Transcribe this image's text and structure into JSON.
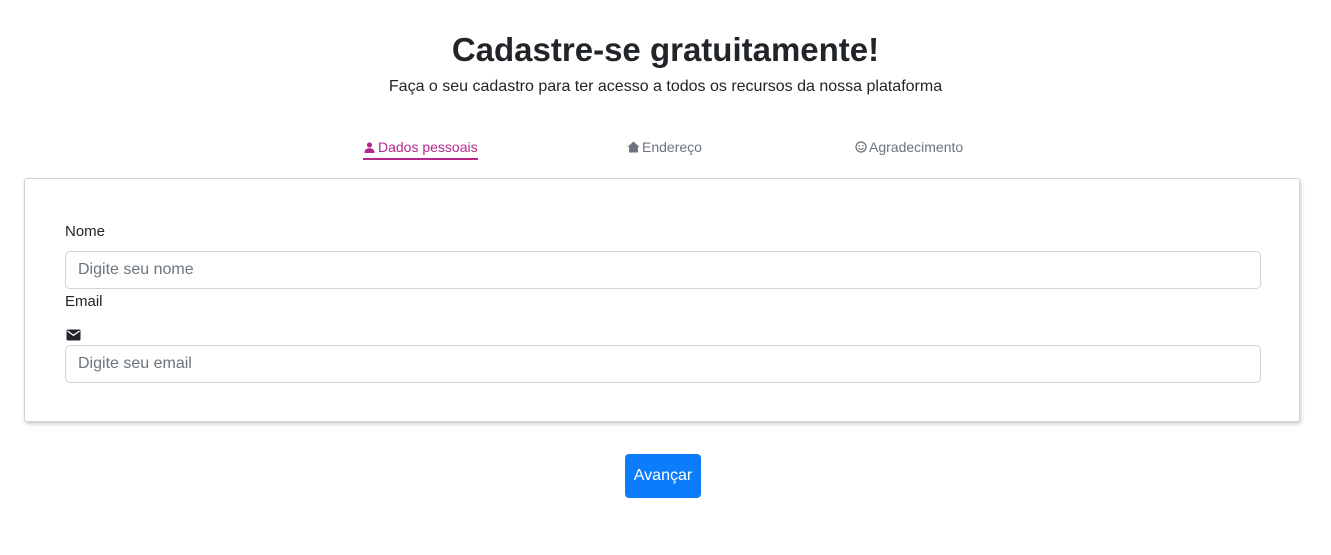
{
  "header": {
    "title": "Cadastre-se gratuitamente!",
    "subtitle": "Faça o seu cadastro para ter acesso a todos os recursos da nossa plataforma"
  },
  "steps": [
    {
      "label": "Dados pessoais",
      "icon": "person-icon",
      "active": true
    },
    {
      "label": "Endereço",
      "icon": "home-icon",
      "active": false
    },
    {
      "label": "Agradecimento",
      "icon": "smiley-icon",
      "active": false
    }
  ],
  "form": {
    "name_label": "Nome",
    "name_placeholder": "Digite seu nome",
    "email_label": "Email",
    "email_icon": "mail-icon",
    "email_placeholder": "Digite seu email"
  },
  "actions": {
    "next_label": "Avançar"
  },
  "colors": {
    "accent": "#b6278c",
    "primary_button": "#0b7dfb",
    "inactive_step": "#6c757d"
  }
}
